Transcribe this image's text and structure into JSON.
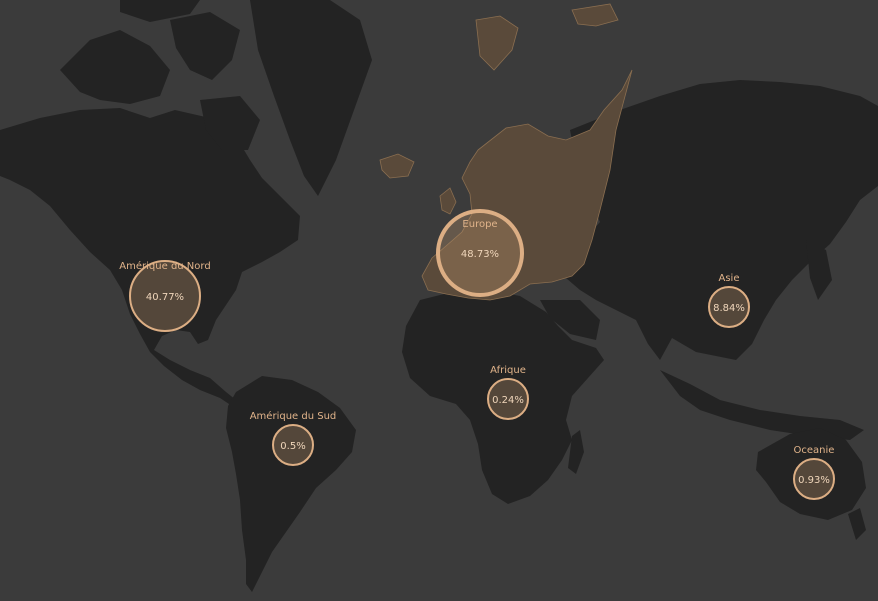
{
  "map": {
    "highlight_color": "#8a6e50",
    "bubble_stroke": "#dcae84",
    "regions": [
      {
        "id": "north-america",
        "label": "Amérique du Nord",
        "value": "40.77%"
      },
      {
        "id": "europe",
        "label": "Europe",
        "value": "48.73%"
      },
      {
        "id": "asia",
        "label": "Asie",
        "value": "8.84%"
      },
      {
        "id": "africa",
        "label": "Afrique",
        "value": "0.24%"
      },
      {
        "id": "south-america",
        "label": "Amérique du Sud",
        "value": "0.5%"
      },
      {
        "id": "oceania",
        "label": "Oceanie",
        "value": "0.93%"
      }
    ]
  }
}
